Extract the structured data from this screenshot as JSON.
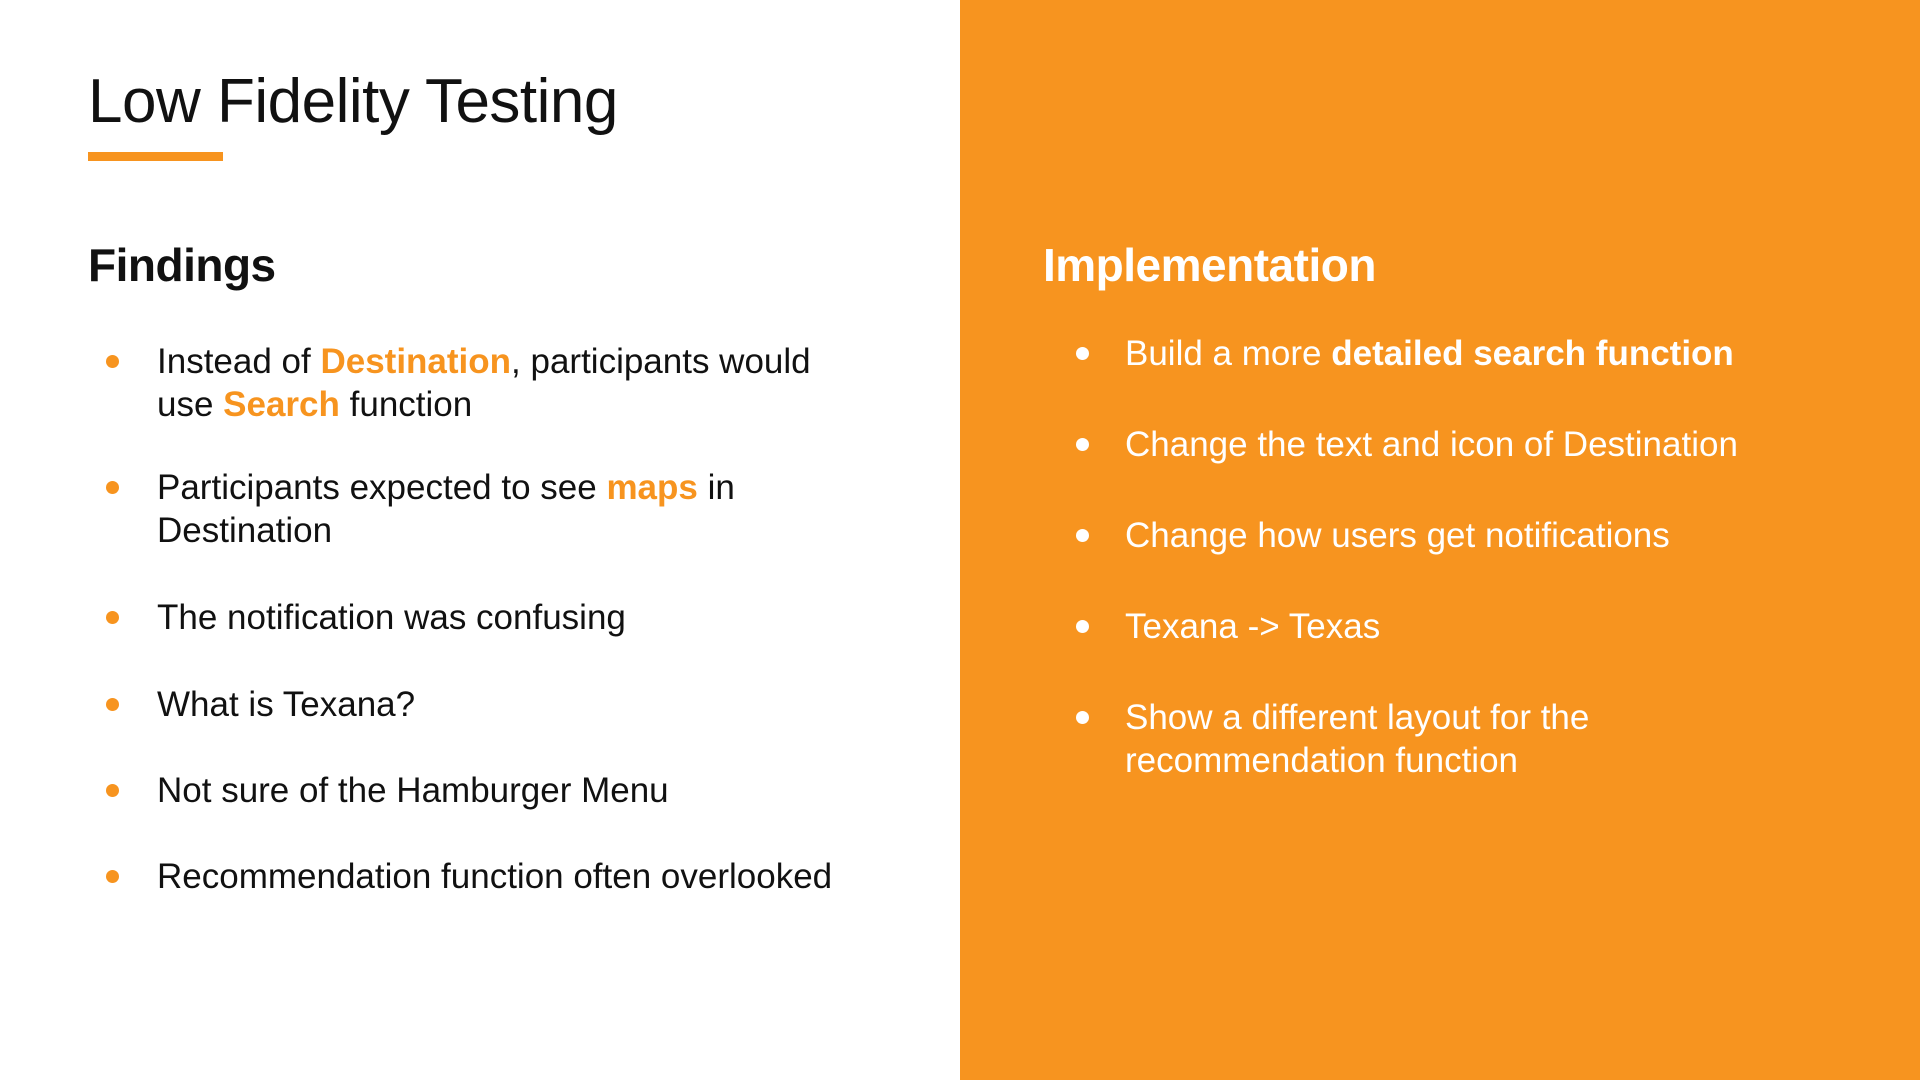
{
  "title": "Low Fidelity Testing",
  "colors": {
    "accent": "#F7941F"
  },
  "findings": {
    "heading": "Findings",
    "items": [
      {
        "parts": [
          "Instead of ",
          "Destination",
          ", participants would use ",
          "Search",
          " function"
        ]
      },
      {
        "parts": [
          "Participants expected to see ",
          "maps",
          " in Destination"
        ]
      },
      {
        "text": "The notification was confusing"
      },
      {
        "text": "What is Texana?"
      },
      {
        "text": "Not sure of the Hamburger Menu"
      },
      {
        "text": "Recommendation function often overlooked"
      }
    ]
  },
  "implementation": {
    "heading": "Implementation",
    "items": [
      {
        "parts": [
          "Build a more ",
          "detailed search function"
        ]
      },
      {
        "text": "Change the text and icon of Destination"
      },
      {
        "text": "Change how users get notifications"
      },
      {
        "text": "Texana -> Texas"
      },
      {
        "text": "Show a different layout for the recommendation function"
      }
    ]
  }
}
